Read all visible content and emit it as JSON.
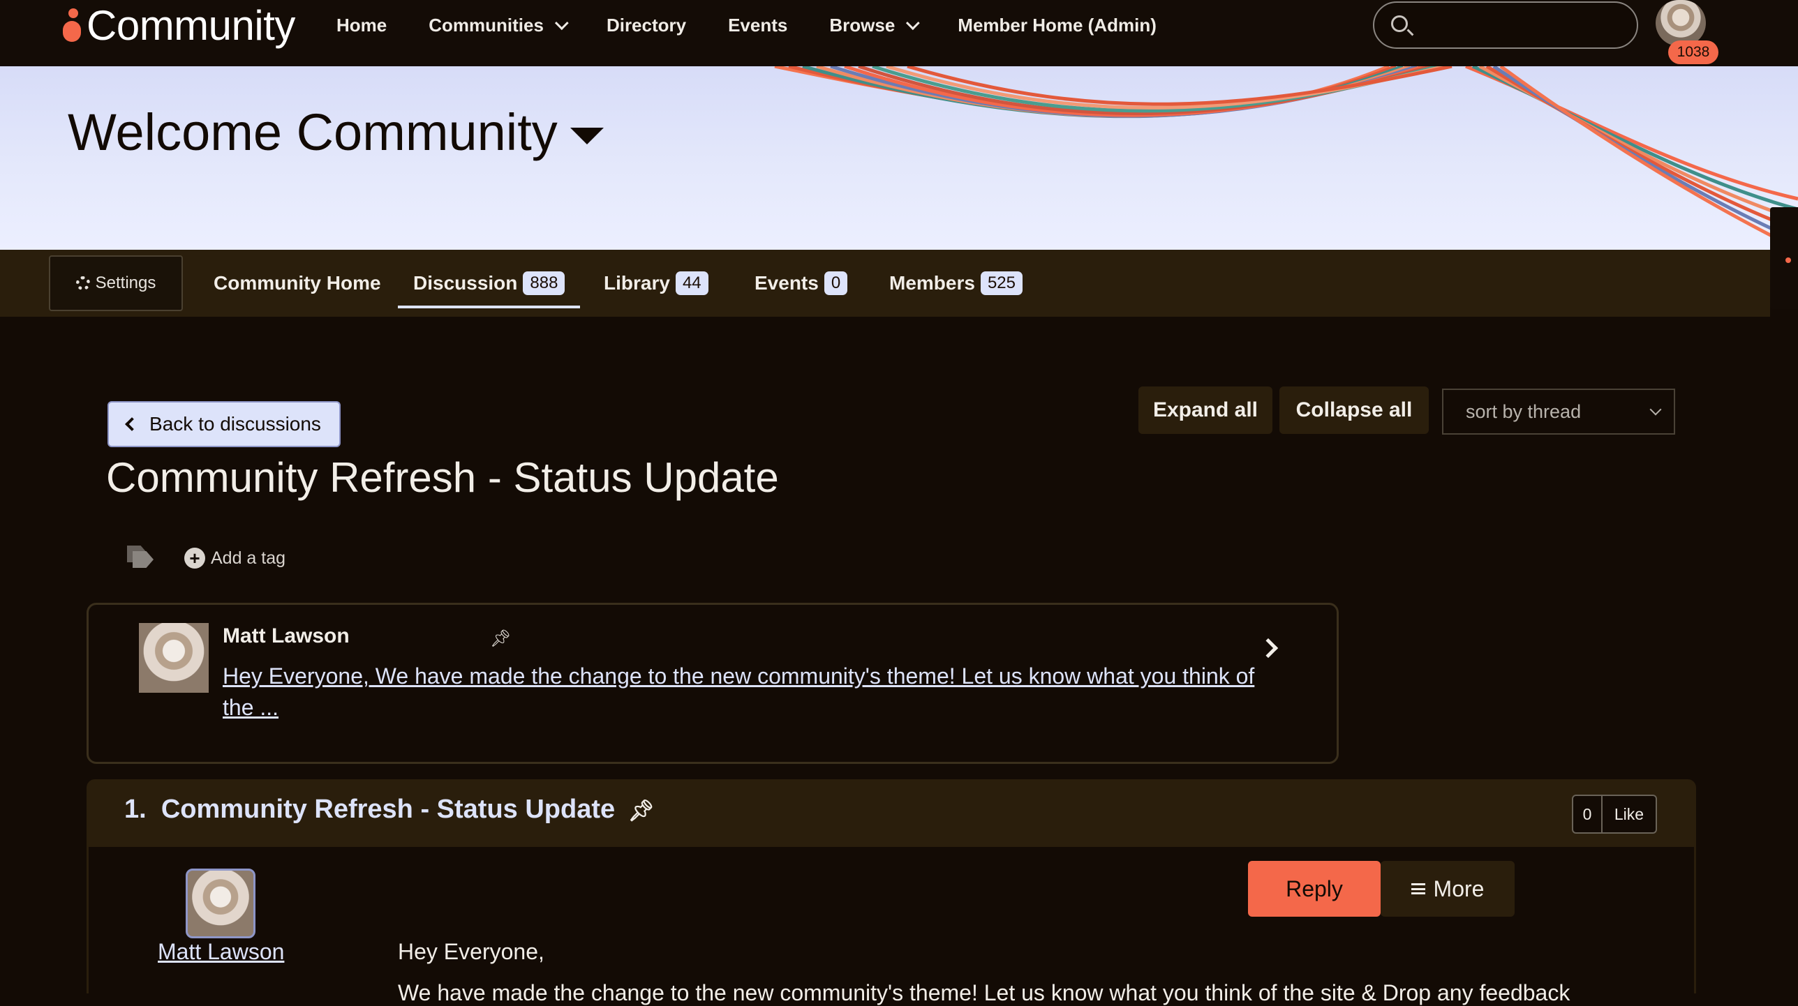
{
  "nav": {
    "logo_text": "Community",
    "items": [
      {
        "label": "Home",
        "has_dropdown": false
      },
      {
        "label": "Communities",
        "has_dropdown": true
      },
      {
        "label": "Directory",
        "has_dropdown": false
      },
      {
        "label": "Events",
        "has_dropdown": false
      },
      {
        "label": "Browse",
        "has_dropdown": true
      },
      {
        "label": "Member Home (Admin)",
        "has_dropdown": false
      }
    ],
    "search_placeholder": "",
    "notification_count": "1038"
  },
  "banner": {
    "title": "Welcome Community"
  },
  "tabs": {
    "settings_label": "Settings",
    "items": [
      {
        "label": "Community Home",
        "count": null
      },
      {
        "label": "Discussion",
        "count": "888",
        "active": true
      },
      {
        "label": "Library",
        "count": "44"
      },
      {
        "label": "Events",
        "count": "0"
      },
      {
        "label": "Members",
        "count": "525"
      }
    ]
  },
  "thread": {
    "back_label": "Back to discussions",
    "title": "Community Refresh - Status Update",
    "expand_all": "Expand all",
    "collapse_all": "Collapse all",
    "sort_value": "sort by thread",
    "add_tag_label": "Add a tag"
  },
  "pinned": {
    "author": "Matt Lawson",
    "excerpt": "Hey Everyone, We have made the change to the new community's theme! Let us know what you think of the ..."
  },
  "reply": {
    "number": "1.",
    "title": "Community Refresh - Status Update",
    "like_count": "0",
    "like_label": "Like",
    "reply_label": "Reply",
    "more_label": "More",
    "author": "Matt Lawson",
    "greeting": "Hey Everyone,",
    "body_line": "We have made the change to the new community's theme! Let us know what you think of the site & Drop any feedback"
  },
  "colors": {
    "accent": "#f4684a",
    "background": "#130b05",
    "bar": "#2a1e0c",
    "highlight": "#dde3fa"
  }
}
